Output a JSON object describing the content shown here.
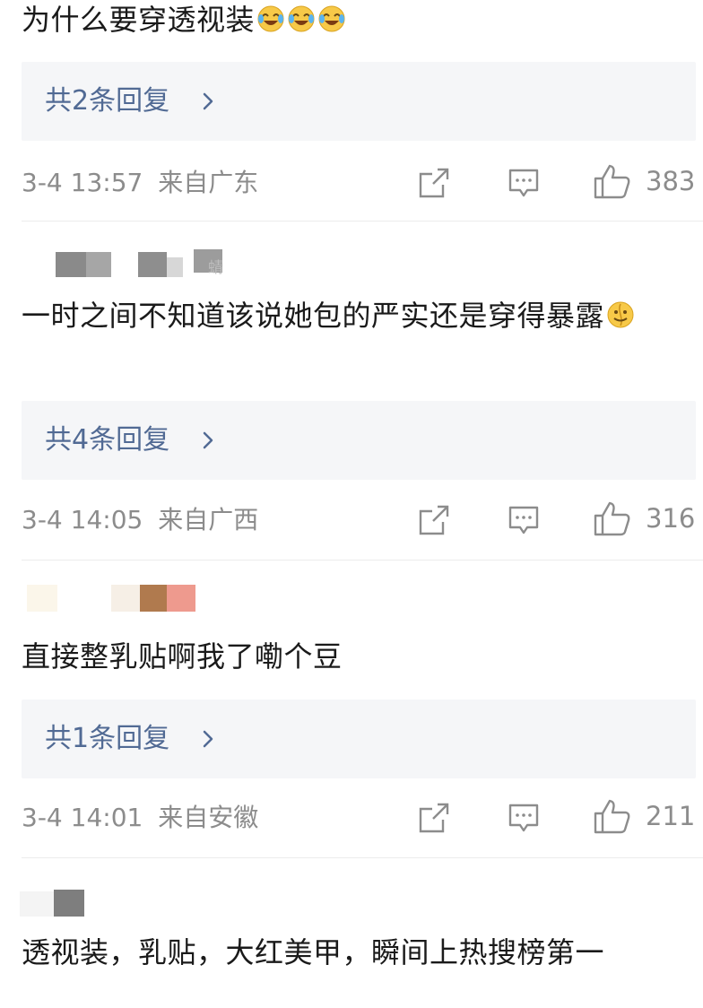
{
  "comments": [
    {
      "text": "为什么要穿透视装",
      "emojis": [
        "laugh-cry-emoji",
        "laugh-cry-emoji",
        "laugh-cry-emoji"
      ],
      "reply_label": "共2条回复",
      "timestamp": "3-4 13:57",
      "location": "来自广东",
      "likes": "383"
    },
    {
      "username": "蜻",
      "text": "一时之间不知道该说她包的严实还是穿得暴露",
      "emojis": [
        "thinking-smile-emoji"
      ],
      "reply_label": "共4条回复",
      "timestamp": "3-4 14:05",
      "location": "来自广西",
      "likes": "316"
    },
    {
      "text": "直接整乳贴啊我了嘞个豆",
      "reply_label": "共1条回复",
      "timestamp": "3-4 14:01",
      "location": "来自安徽",
      "likes": "211"
    },
    {
      "text": "透视装，乳贴，大红美甲，瞬间上热搜榜第一"
    }
  ],
  "colors": {
    "reply_link": "#516a94",
    "meta_gray": "#8c8c8c",
    "reply_bg": "#f5f6f8"
  },
  "icons": [
    "forward-icon",
    "comment-icon",
    "like-icon",
    "chevron-right-icon"
  ]
}
